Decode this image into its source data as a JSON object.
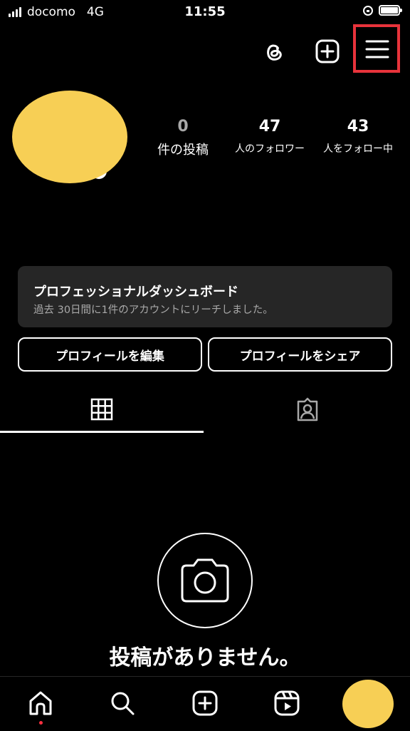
{
  "status_bar": {
    "carrier": "docomo",
    "network": "4G",
    "time": "11:55"
  },
  "profile": {
    "stats": [
      {
        "value": "0",
        "label": "件の投稿"
      },
      {
        "value": "47",
        "label": "人のフォロワー"
      },
      {
        "value": "43",
        "label": "人をフォロー中"
      }
    ]
  },
  "dashboard": {
    "title": "プロフェッショナルダッシュボード",
    "subtitle": "過去 30日間に1件のアカウントにリーチしました。"
  },
  "buttons": {
    "edit_profile": "プロフィールを編集",
    "share_profile": "プロフィールをシェア"
  },
  "empty_state": {
    "text": "投稿がありません。"
  },
  "colors": {
    "avatar": "#f7cf55",
    "highlight": "#e8333b",
    "dashboard_bg": "#262626",
    "notification_dot": "#ff3040"
  },
  "icons": [
    "threads-icon",
    "create-icon",
    "menu-icon",
    "grid-icon",
    "tagged-icon",
    "camera-icon",
    "home-icon",
    "search-icon",
    "create-post-icon",
    "reels-icon"
  ]
}
